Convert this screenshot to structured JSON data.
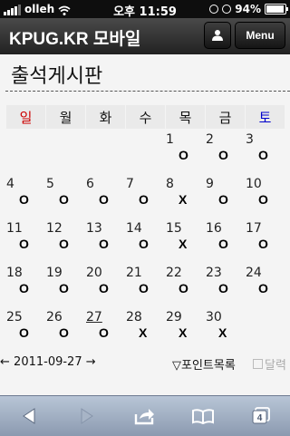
{
  "status": {
    "carrier": "olleh",
    "time": "오후 11:59",
    "battery": "94%",
    "battery_level": 0.94
  },
  "header": {
    "title": "KPUG.KR 모바일",
    "menu_label": "Menu"
  },
  "board": {
    "title": "출석게시판"
  },
  "weekdays": [
    "일",
    "월",
    "화",
    "수",
    "목",
    "금",
    "토"
  ],
  "calendar": {
    "rows": [
      [
        {
          "d": "",
          "m": ""
        },
        {
          "d": "",
          "m": ""
        },
        {
          "d": "",
          "m": ""
        },
        {
          "d": "",
          "m": ""
        },
        {
          "d": "1",
          "m": "O"
        },
        {
          "d": "2",
          "m": "O"
        },
        {
          "d": "3",
          "m": "O"
        }
      ],
      [
        {
          "d": "4",
          "m": "O"
        },
        {
          "d": "5",
          "m": "O"
        },
        {
          "d": "6",
          "m": "O"
        },
        {
          "d": "7",
          "m": "O"
        },
        {
          "d": "8",
          "m": "X"
        },
        {
          "d": "9",
          "m": "O"
        },
        {
          "d": "10",
          "m": "O"
        }
      ],
      [
        {
          "d": "11",
          "m": "O"
        },
        {
          "d": "12",
          "m": "O"
        },
        {
          "d": "13",
          "m": "O"
        },
        {
          "d": "14",
          "m": "O"
        },
        {
          "d": "15",
          "m": "X"
        },
        {
          "d": "16",
          "m": "O"
        },
        {
          "d": "17",
          "m": "O"
        }
      ],
      [
        {
          "d": "18",
          "m": "O"
        },
        {
          "d": "19",
          "m": "O"
        },
        {
          "d": "20",
          "m": "O"
        },
        {
          "d": "21",
          "m": "O"
        },
        {
          "d": "22",
          "m": "O"
        },
        {
          "d": "23",
          "m": "O"
        },
        {
          "d": "24",
          "m": "O"
        }
      ],
      [
        {
          "d": "25",
          "m": "O"
        },
        {
          "d": "26",
          "m": "O"
        },
        {
          "d": "27",
          "m": "O"
        },
        {
          "d": "28",
          "m": "X"
        },
        {
          "d": "29",
          "m": "X"
        },
        {
          "d": "30",
          "m": "X"
        },
        {
          "d": "",
          "m": ""
        }
      ]
    ],
    "today": "27"
  },
  "nav": {
    "prev": "←",
    "date": "2011-09-27",
    "next": "→",
    "points_label": "▽포인트목록",
    "calendar_label": "달력"
  }
}
